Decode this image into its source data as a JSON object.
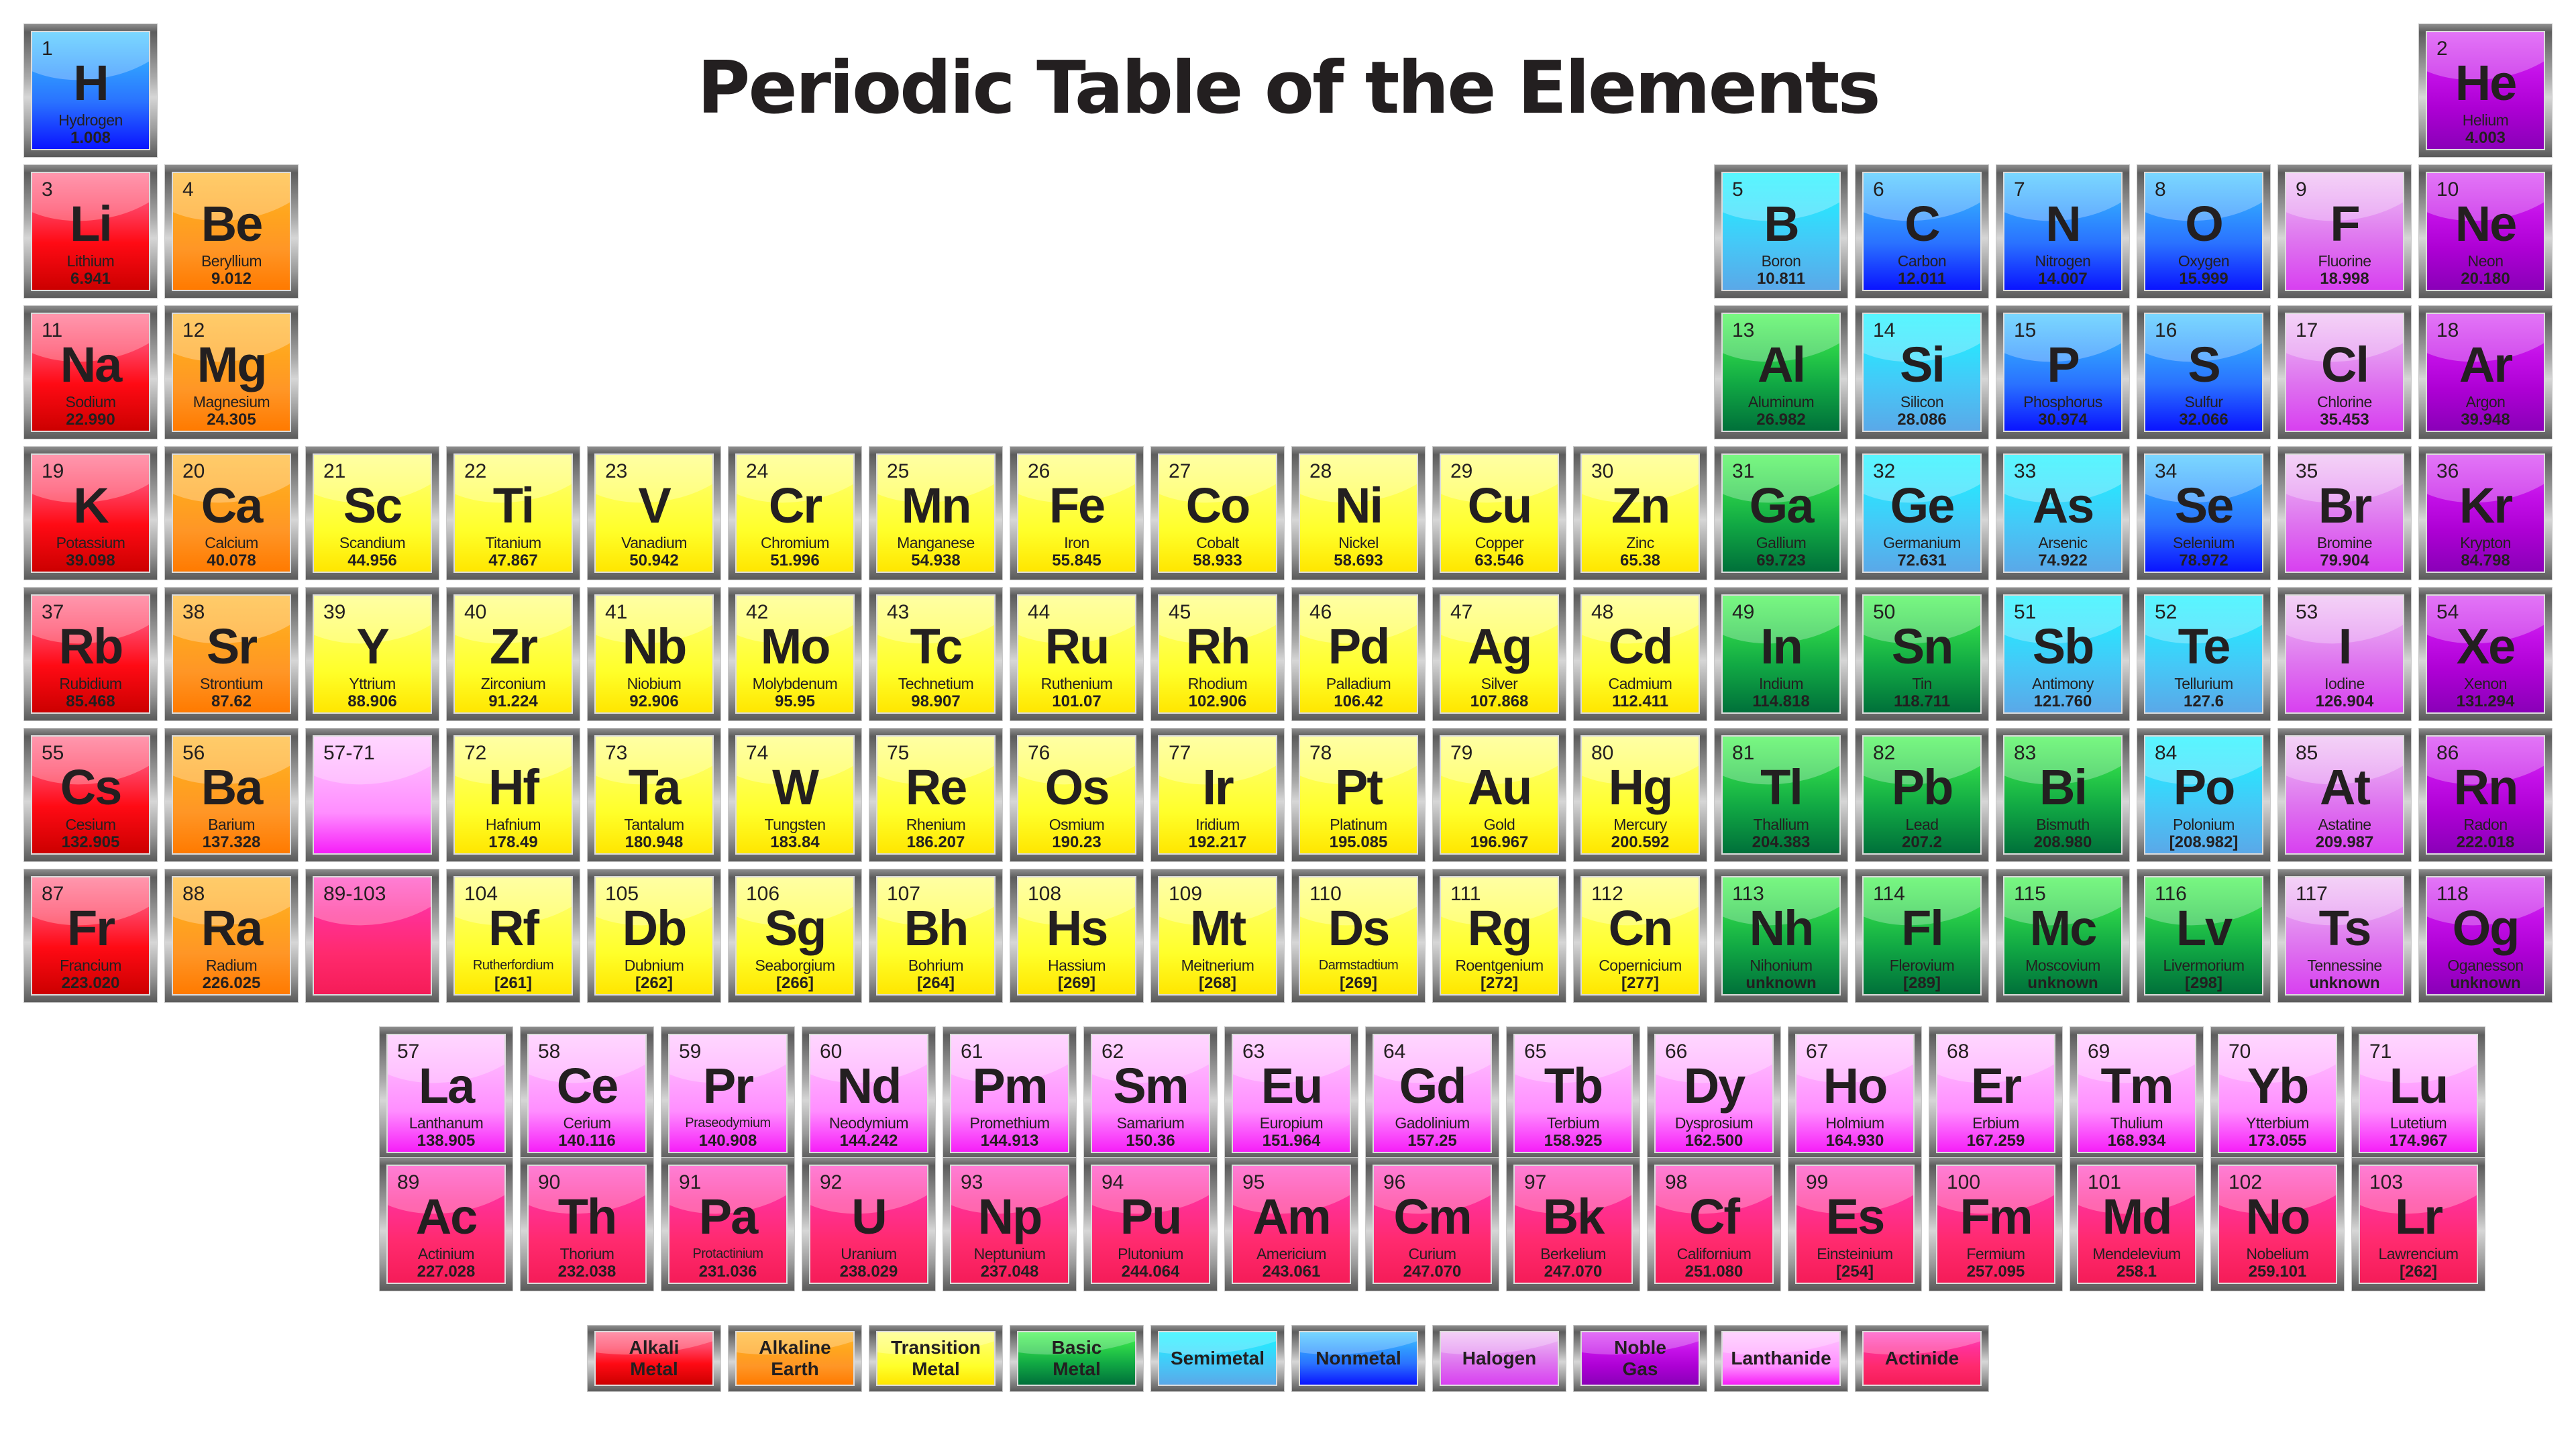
{
  "title": "Periodic Table of the Elements",
  "categories": {
    "alkali": {
      "label": "Alkali\nMetal",
      "color": "#ff0a14"
    },
    "alkaline": {
      "label": "Alkaline\nEarth",
      "color": "#ff9626"
    },
    "transition": {
      "label": "Transition\nMetal",
      "color": "#ffff2a"
    },
    "basic": {
      "label": "Basic\nMetal",
      "color": "#11a844"
    },
    "semimetal": {
      "label": "Semimetal",
      "color": "#2ee0fd"
    },
    "nonmetal": {
      "label": "Nonmetal",
      "color": "#2a72ff"
    },
    "halogen": {
      "label": "Halogen",
      "color": "#de72ef"
    },
    "noble": {
      "label": "Noble\nGas",
      "color": "#ad00d4"
    },
    "lanthanide": {
      "label": "Lanthanide",
      "color": "#ff8eff"
    },
    "actinide": {
      "label": "Actinide",
      "color": "#ff2a6e"
    }
  },
  "legend_order": [
    "alkali",
    "alkaline",
    "transition",
    "basic",
    "semimetal",
    "nonmetal",
    "halogen",
    "noble",
    "lanthanide",
    "actinide"
  ],
  "placeholders": [
    {
      "label": "57-71",
      "category": "lanthanide",
      "period": 6,
      "group": 3
    },
    {
      "label": "89-103",
      "category": "actinide",
      "period": 7,
      "group": 3
    }
  ],
  "elements": [
    {
      "n": 1,
      "sym": "H",
      "name": "Hydrogen",
      "mass": "1.008",
      "cat": "nonmetal",
      "p": 1,
      "g": 1
    },
    {
      "n": 2,
      "sym": "He",
      "name": "Helium",
      "mass": "4.003",
      "cat": "noble",
      "p": 1,
      "g": 18
    },
    {
      "n": 3,
      "sym": "Li",
      "name": "Lithium",
      "mass": "6.941",
      "cat": "alkali",
      "p": 2,
      "g": 1
    },
    {
      "n": 4,
      "sym": "Be",
      "name": "Beryllium",
      "mass": "9.012",
      "cat": "alkaline",
      "p": 2,
      "g": 2
    },
    {
      "n": 5,
      "sym": "B",
      "name": "Boron",
      "mass": "10.811",
      "cat": "semimetal",
      "p": 2,
      "g": 13
    },
    {
      "n": 6,
      "sym": "C",
      "name": "Carbon",
      "mass": "12.011",
      "cat": "nonmetal",
      "p": 2,
      "g": 14
    },
    {
      "n": 7,
      "sym": "N",
      "name": "Nitrogen",
      "mass": "14.007",
      "cat": "nonmetal",
      "p": 2,
      "g": 15
    },
    {
      "n": 8,
      "sym": "O",
      "name": "Oxygen",
      "mass": "15.999",
      "cat": "nonmetal",
      "p": 2,
      "g": 16
    },
    {
      "n": 9,
      "sym": "F",
      "name": "Fluorine",
      "mass": "18.998",
      "cat": "halogen",
      "p": 2,
      "g": 17
    },
    {
      "n": 10,
      "sym": "Ne",
      "name": "Neon",
      "mass": "20.180",
      "cat": "noble",
      "p": 2,
      "g": 18
    },
    {
      "n": 11,
      "sym": "Na",
      "name": "Sodium",
      "mass": "22.990",
      "cat": "alkali",
      "p": 3,
      "g": 1
    },
    {
      "n": 12,
      "sym": "Mg",
      "name": "Magnesium",
      "mass": "24.305",
      "cat": "alkaline",
      "p": 3,
      "g": 2
    },
    {
      "n": 13,
      "sym": "Al",
      "name": "Aluminum",
      "mass": "26.982",
      "cat": "basic",
      "p": 3,
      "g": 13
    },
    {
      "n": 14,
      "sym": "Si",
      "name": "Silicon",
      "mass": "28.086",
      "cat": "semimetal",
      "p": 3,
      "g": 14
    },
    {
      "n": 15,
      "sym": "P",
      "name": "Phosphorus",
      "mass": "30.974",
      "cat": "nonmetal",
      "p": 3,
      "g": 15
    },
    {
      "n": 16,
      "sym": "S",
      "name": "Sulfur",
      "mass": "32.066",
      "cat": "nonmetal",
      "p": 3,
      "g": 16
    },
    {
      "n": 17,
      "sym": "Cl",
      "name": "Chlorine",
      "mass": "35.453",
      "cat": "halogen",
      "p": 3,
      "g": 17
    },
    {
      "n": 18,
      "sym": "Ar",
      "name": "Argon",
      "mass": "39.948",
      "cat": "noble",
      "p": 3,
      "g": 18
    },
    {
      "n": 19,
      "sym": "K",
      "name": "Potassium",
      "mass": "39.098",
      "cat": "alkali",
      "p": 4,
      "g": 1
    },
    {
      "n": 20,
      "sym": "Ca",
      "name": "Calcium",
      "mass": "40.078",
      "cat": "alkaline",
      "p": 4,
      "g": 2
    },
    {
      "n": 21,
      "sym": "Sc",
      "name": "Scandium",
      "mass": "44.956",
      "cat": "transition",
      "p": 4,
      "g": 3
    },
    {
      "n": 22,
      "sym": "Ti",
      "name": "Titanium",
      "mass": "47.867",
      "cat": "transition",
      "p": 4,
      "g": 4
    },
    {
      "n": 23,
      "sym": "V",
      "name": "Vanadium",
      "mass": "50.942",
      "cat": "transition",
      "p": 4,
      "g": 5
    },
    {
      "n": 24,
      "sym": "Cr",
      "name": "Chromium",
      "mass": "51.996",
      "cat": "transition",
      "p": 4,
      "g": 6
    },
    {
      "n": 25,
      "sym": "Mn",
      "name": "Manganese",
      "mass": "54.938",
      "cat": "transition",
      "p": 4,
      "g": 7
    },
    {
      "n": 26,
      "sym": "Fe",
      "name": "Iron",
      "mass": "55.845",
      "cat": "transition",
      "p": 4,
      "g": 8
    },
    {
      "n": 27,
      "sym": "Co",
      "name": "Cobalt",
      "mass": "58.933",
      "cat": "transition",
      "p": 4,
      "g": 9
    },
    {
      "n": 28,
      "sym": "Ni",
      "name": "Nickel",
      "mass": "58.693",
      "cat": "transition",
      "p": 4,
      "g": 10
    },
    {
      "n": 29,
      "sym": "Cu",
      "name": "Copper",
      "mass": "63.546",
      "cat": "transition",
      "p": 4,
      "g": 11
    },
    {
      "n": 30,
      "sym": "Zn",
      "name": "Zinc",
      "mass": "65.38",
      "cat": "transition",
      "p": 4,
      "g": 12
    },
    {
      "n": 31,
      "sym": "Ga",
      "name": "Gallium",
      "mass": "69.723",
      "cat": "basic",
      "p": 4,
      "g": 13
    },
    {
      "n": 32,
      "sym": "Ge",
      "name": "Germanium",
      "mass": "72.631",
      "cat": "semimetal",
      "p": 4,
      "g": 14
    },
    {
      "n": 33,
      "sym": "As",
      "name": "Arsenic",
      "mass": "74.922",
      "cat": "semimetal",
      "p": 4,
      "g": 15
    },
    {
      "n": 34,
      "sym": "Se",
      "name": "Selenium",
      "mass": "78.972",
      "cat": "nonmetal",
      "p": 4,
      "g": 16
    },
    {
      "n": 35,
      "sym": "Br",
      "name": "Bromine",
      "mass": "79.904",
      "cat": "halogen",
      "p": 4,
      "g": 17
    },
    {
      "n": 36,
      "sym": "Kr",
      "name": "Krypton",
      "mass": "84.798",
      "cat": "noble",
      "p": 4,
      "g": 18
    },
    {
      "n": 37,
      "sym": "Rb",
      "name": "Rubidium",
      "mass": "85.468",
      "cat": "alkali",
      "p": 5,
      "g": 1
    },
    {
      "n": 38,
      "sym": "Sr",
      "name": "Strontium",
      "mass": "87.62",
      "cat": "alkaline",
      "p": 5,
      "g": 2
    },
    {
      "n": 39,
      "sym": "Y",
      "name": "Yttrium",
      "mass": "88.906",
      "cat": "transition",
      "p": 5,
      "g": 3
    },
    {
      "n": 40,
      "sym": "Zr",
      "name": "Zirconium",
      "mass": "91.224",
      "cat": "transition",
      "p": 5,
      "g": 4
    },
    {
      "n": 41,
      "sym": "Nb",
      "name": "Niobium",
      "mass": "92.906",
      "cat": "transition",
      "p": 5,
      "g": 5
    },
    {
      "n": 42,
      "sym": "Mo",
      "name": "Molybdenum",
      "mass": "95.95",
      "cat": "transition",
      "p": 5,
      "g": 6
    },
    {
      "n": 43,
      "sym": "Tc",
      "name": "Technetium",
      "mass": "98.907",
      "cat": "transition",
      "p": 5,
      "g": 7
    },
    {
      "n": 44,
      "sym": "Ru",
      "name": "Ruthenium",
      "mass": "101.07",
      "cat": "transition",
      "p": 5,
      "g": 8
    },
    {
      "n": 45,
      "sym": "Rh",
      "name": "Rhodium",
      "mass": "102.906",
      "cat": "transition",
      "p": 5,
      "g": 9
    },
    {
      "n": 46,
      "sym": "Pd",
      "name": "Palladium",
      "mass": "106.42",
      "cat": "transition",
      "p": 5,
      "g": 10
    },
    {
      "n": 47,
      "sym": "Ag",
      "name": "Silver",
      "mass": "107.868",
      "cat": "transition",
      "p": 5,
      "g": 11
    },
    {
      "n": 48,
      "sym": "Cd",
      "name": "Cadmium",
      "mass": "112.411",
      "cat": "transition",
      "p": 5,
      "g": 12
    },
    {
      "n": 49,
      "sym": "In",
      "name": "Indium",
      "mass": "114.818",
      "cat": "basic",
      "p": 5,
      "g": 13
    },
    {
      "n": 50,
      "sym": "Sn",
      "name": "Tin",
      "mass": "118.711",
      "cat": "basic",
      "p": 5,
      "g": 14
    },
    {
      "n": 51,
      "sym": "Sb",
      "name": "Antimony",
      "mass": "121.760",
      "cat": "semimetal",
      "p": 5,
      "g": 15
    },
    {
      "n": 52,
      "sym": "Te",
      "name": "Tellurium",
      "mass": "127.6",
      "cat": "semimetal",
      "p": 5,
      "g": 16
    },
    {
      "n": 53,
      "sym": "I",
      "name": "Iodine",
      "mass": "126.904",
      "cat": "halogen",
      "p": 5,
      "g": 17
    },
    {
      "n": 54,
      "sym": "Xe",
      "name": "Xenon",
      "mass": "131.294",
      "cat": "noble",
      "p": 5,
      "g": 18
    },
    {
      "n": 55,
      "sym": "Cs",
      "name": "Cesium",
      "mass": "132.905",
      "cat": "alkali",
      "p": 6,
      "g": 1
    },
    {
      "n": 56,
      "sym": "Ba",
      "name": "Barium",
      "mass": "137.328",
      "cat": "alkaline",
      "p": 6,
      "g": 2
    },
    {
      "n": 72,
      "sym": "Hf",
      "name": "Hafnium",
      "mass": "178.49",
      "cat": "transition",
      "p": 6,
      "g": 4
    },
    {
      "n": 73,
      "sym": "Ta",
      "name": "Tantalum",
      "mass": "180.948",
      "cat": "transition",
      "p": 6,
      "g": 5
    },
    {
      "n": 74,
      "sym": "W",
      "name": "Tungsten",
      "mass": "183.84",
      "cat": "transition",
      "p": 6,
      "g": 6
    },
    {
      "n": 75,
      "sym": "Re",
      "name": "Rhenium",
      "mass": "186.207",
      "cat": "transition",
      "p": 6,
      "g": 7
    },
    {
      "n": 76,
      "sym": "Os",
      "name": "Osmium",
      "mass": "190.23",
      "cat": "transition",
      "p": 6,
      "g": 8
    },
    {
      "n": 77,
      "sym": "Ir",
      "name": "Iridium",
      "mass": "192.217",
      "cat": "transition",
      "p": 6,
      "g": 9
    },
    {
      "n": 78,
      "sym": "Pt",
      "name": "Platinum",
      "mass": "195.085",
      "cat": "transition",
      "p": 6,
      "g": 10
    },
    {
      "n": 79,
      "sym": "Au",
      "name": "Gold",
      "mass": "196.967",
      "cat": "transition",
      "p": 6,
      "g": 11
    },
    {
      "n": 80,
      "sym": "Hg",
      "name": "Mercury",
      "mass": "200.592",
      "cat": "transition",
      "p": 6,
      "g": 12
    },
    {
      "n": 81,
      "sym": "Tl",
      "name": "Thallium",
      "mass": "204.383",
      "cat": "basic",
      "p": 6,
      "g": 13
    },
    {
      "n": 82,
      "sym": "Pb",
      "name": "Lead",
      "mass": "207.2",
      "cat": "basic",
      "p": 6,
      "g": 14
    },
    {
      "n": 83,
      "sym": "Bi",
      "name": "Bismuth",
      "mass": "208.980",
      "cat": "basic",
      "p": 6,
      "g": 15
    },
    {
      "n": 84,
      "sym": "Po",
      "name": "Polonium",
      "mass": "[208.982]",
      "cat": "semimetal",
      "p": 6,
      "g": 16
    },
    {
      "n": 85,
      "sym": "At",
      "name": "Astatine",
      "mass": "209.987",
      "cat": "halogen",
      "p": 6,
      "g": 17
    },
    {
      "n": 86,
      "sym": "Rn",
      "name": "Radon",
      "mass": "222.018",
      "cat": "noble",
      "p": 6,
      "g": 18
    },
    {
      "n": 87,
      "sym": "Fr",
      "name": "Francium",
      "mass": "223.020",
      "cat": "alkali",
      "p": 7,
      "g": 1
    },
    {
      "n": 88,
      "sym": "Ra",
      "name": "Radium",
      "mass": "226.025",
      "cat": "alkaline",
      "p": 7,
      "g": 2
    },
    {
      "n": 104,
      "sym": "Rf",
      "name": "Rutherfordium",
      "mass": "[261]",
      "cat": "transition",
      "p": 7,
      "g": 4
    },
    {
      "n": 105,
      "sym": "Db",
      "name": "Dubnium",
      "mass": "[262]",
      "cat": "transition",
      "p": 7,
      "g": 5
    },
    {
      "n": 106,
      "sym": "Sg",
      "name": "Seaborgium",
      "mass": "[266]",
      "cat": "transition",
      "p": 7,
      "g": 6
    },
    {
      "n": 107,
      "sym": "Bh",
      "name": "Bohrium",
      "mass": "[264]",
      "cat": "transition",
      "p": 7,
      "g": 7
    },
    {
      "n": 108,
      "sym": "Hs",
      "name": "Hassium",
      "mass": "[269]",
      "cat": "transition",
      "p": 7,
      "g": 8
    },
    {
      "n": 109,
      "sym": "Mt",
      "name": "Meitnerium",
      "mass": "[268]",
      "cat": "transition",
      "p": 7,
      "g": 9
    },
    {
      "n": 110,
      "sym": "Ds",
      "name": "Darmstadtium",
      "mass": "[269]",
      "cat": "transition",
      "p": 7,
      "g": 10
    },
    {
      "n": 111,
      "sym": "Rg",
      "name": "Roentgenium",
      "mass": "[272]",
      "cat": "transition",
      "p": 7,
      "g": 11
    },
    {
      "n": 112,
      "sym": "Cn",
      "name": "Copernicium",
      "mass": "[277]",
      "cat": "transition",
      "p": 7,
      "g": 12
    },
    {
      "n": 113,
      "sym": "Nh",
      "name": "Nihonium",
      "mass": "unknown",
      "cat": "basic",
      "p": 7,
      "g": 13
    },
    {
      "n": 114,
      "sym": "Fl",
      "name": "Flerovium",
      "mass": "[289]",
      "cat": "basic",
      "p": 7,
      "g": 14
    },
    {
      "n": 115,
      "sym": "Mc",
      "name": "Moscovium",
      "mass": "unknown",
      "cat": "basic",
      "p": 7,
      "g": 15
    },
    {
      "n": 116,
      "sym": "Lv",
      "name": "Livermorium",
      "mass": "[298]",
      "cat": "basic",
      "p": 7,
      "g": 16
    },
    {
      "n": 117,
      "sym": "Ts",
      "name": "Tennessine",
      "mass": "unknown",
      "cat": "halogen",
      "p": 7,
      "g": 17
    },
    {
      "n": 118,
      "sym": "Og",
      "name": "Oganesson",
      "mass": "unknown",
      "cat": "noble",
      "p": 7,
      "g": 18
    },
    {
      "n": 57,
      "sym": "La",
      "name": "Lanthanum",
      "mass": "138.905",
      "cat": "lanthanide",
      "f": 1,
      "i": 0
    },
    {
      "n": 58,
      "sym": "Ce",
      "name": "Cerium",
      "mass": "140.116",
      "cat": "lanthanide",
      "f": 1,
      "i": 1
    },
    {
      "n": 59,
      "sym": "Pr",
      "name": "Praseodymium",
      "mass": "140.908",
      "cat": "lanthanide",
      "f": 1,
      "i": 2
    },
    {
      "n": 60,
      "sym": "Nd",
      "name": "Neodymium",
      "mass": "144.242",
      "cat": "lanthanide",
      "f": 1,
      "i": 3
    },
    {
      "n": 61,
      "sym": "Pm",
      "name": "Promethium",
      "mass": "144.913",
      "cat": "lanthanide",
      "f": 1,
      "i": 4
    },
    {
      "n": 62,
      "sym": "Sm",
      "name": "Samarium",
      "mass": "150.36",
      "cat": "lanthanide",
      "f": 1,
      "i": 5
    },
    {
      "n": 63,
      "sym": "Eu",
      "name": "Europium",
      "mass": "151.964",
      "cat": "lanthanide",
      "f": 1,
      "i": 6
    },
    {
      "n": 64,
      "sym": "Gd",
      "name": "Gadolinium",
      "mass": "157.25",
      "cat": "lanthanide",
      "f": 1,
      "i": 7
    },
    {
      "n": 65,
      "sym": "Tb",
      "name": "Terbium",
      "mass": "158.925",
      "cat": "lanthanide",
      "f": 1,
      "i": 8
    },
    {
      "n": 66,
      "sym": "Dy",
      "name": "Dysprosium",
      "mass": "162.500",
      "cat": "lanthanide",
      "f": 1,
      "i": 9
    },
    {
      "n": 67,
      "sym": "Ho",
      "name": "Holmium",
      "mass": "164.930",
      "cat": "lanthanide",
      "f": 1,
      "i": 10
    },
    {
      "n": 68,
      "sym": "Er",
      "name": "Erbium",
      "mass": "167.259",
      "cat": "lanthanide",
      "f": 1,
      "i": 11
    },
    {
      "n": 69,
      "sym": "Tm",
      "name": "Thulium",
      "mass": "168.934",
      "cat": "lanthanide",
      "f": 1,
      "i": 12
    },
    {
      "n": 70,
      "sym": "Yb",
      "name": "Ytterbium",
      "mass": "173.055",
      "cat": "lanthanide",
      "f": 1,
      "i": 13
    },
    {
      "n": 71,
      "sym": "Lu",
      "name": "Lutetium",
      "mass": "174.967",
      "cat": "lanthanide",
      "f": 1,
      "i": 14
    },
    {
      "n": 89,
      "sym": "Ac",
      "name": "Actinium",
      "mass": "227.028",
      "cat": "actinide",
      "f": 2,
      "i": 0
    },
    {
      "n": 90,
      "sym": "Th",
      "name": "Thorium",
      "mass": "232.038",
      "cat": "actinide",
      "f": 2,
      "i": 1
    },
    {
      "n": 91,
      "sym": "Pa",
      "name": "Protactinium",
      "mass": "231.036",
      "cat": "actinide",
      "f": 2,
      "i": 2
    },
    {
      "n": 92,
      "sym": "U",
      "name": "Uranium",
      "mass": "238.029",
      "cat": "actinide",
      "f": 2,
      "i": 3
    },
    {
      "n": 93,
      "sym": "Np",
      "name": "Neptunium",
      "mass": "237.048",
      "cat": "actinide",
      "f": 2,
      "i": 4
    },
    {
      "n": 94,
      "sym": "Pu",
      "name": "Plutonium",
      "mass": "244.064",
      "cat": "actinide",
      "f": 2,
      "i": 5
    },
    {
      "n": 95,
      "sym": "Am",
      "name": "Americium",
      "mass": "243.061",
      "cat": "actinide",
      "f": 2,
      "i": 6
    },
    {
      "n": 96,
      "sym": "Cm",
      "name": "Curium",
      "mass": "247.070",
      "cat": "actinide",
      "f": 2,
      "i": 7
    },
    {
      "n": 97,
      "sym": "Bk",
      "name": "Berkelium",
      "mass": "247.070",
      "cat": "actinide",
      "f": 2,
      "i": 8
    },
    {
      "n": 98,
      "sym": "Cf",
      "name": "Californium",
      "mass": "251.080",
      "cat": "actinide",
      "f": 2,
      "i": 9
    },
    {
      "n": 99,
      "sym": "Es",
      "name": "Einsteinium",
      "mass": "[254]",
      "cat": "actinide",
      "f": 2,
      "i": 10
    },
    {
      "n": 100,
      "sym": "Fm",
      "name": "Fermium",
      "mass": "257.095",
      "cat": "actinide",
      "f": 2,
      "i": 11
    },
    {
      "n": 101,
      "sym": "Md",
      "name": "Mendelevium",
      "mass": "258.1",
      "cat": "actinide",
      "f": 2,
      "i": 12
    },
    {
      "n": 102,
      "sym": "No",
      "name": "Nobelium",
      "mass": "259.101",
      "cat": "actinide",
      "f": 2,
      "i": 13
    },
    {
      "n": 103,
      "sym": "Lr",
      "name": "Lawrencium",
      "mass": "[262]",
      "cat": "actinide",
      "f": 2,
      "i": 14
    }
  ]
}
